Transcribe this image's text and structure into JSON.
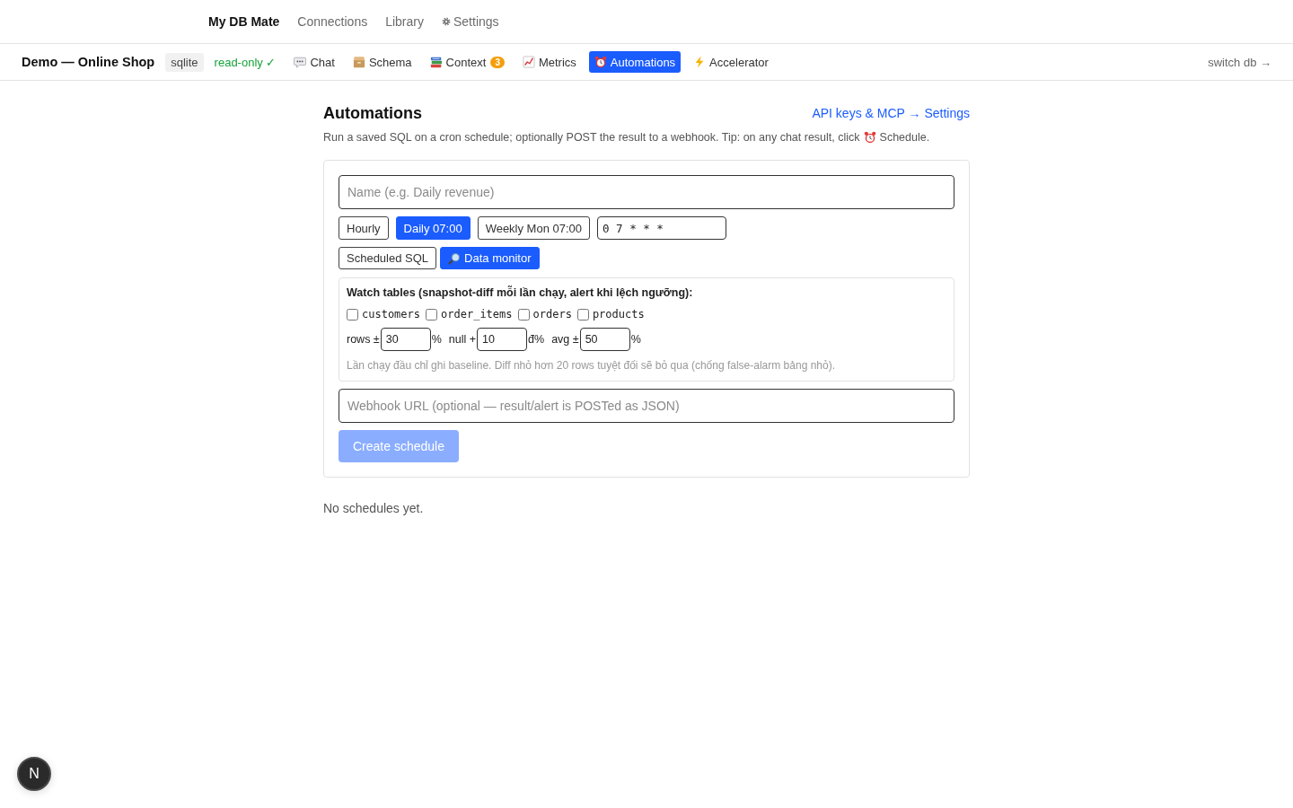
{
  "top_nav": {
    "brand": "My DB Mate",
    "links": [
      {
        "label": "Connections"
      },
      {
        "label": "Library"
      },
      {
        "label": "Settings"
      }
    ]
  },
  "db_bar": {
    "db_name": "Demo — Online Shop",
    "engine": "sqlite",
    "access": "read-only ✓",
    "tabs": [
      {
        "label": "Chat",
        "selected": false
      },
      {
        "label": "Schema",
        "selected": false
      },
      {
        "label": "Context",
        "badge": "3",
        "selected": false
      },
      {
        "label": "Metrics",
        "selected": false
      },
      {
        "label": "Automations",
        "selected": true
      },
      {
        "label": "Accelerator",
        "selected": false
      }
    ],
    "switch_link": "switch db →"
  },
  "page": {
    "title": "Automations",
    "settings_link": "API keys & MCP → Settings",
    "description": {
      "text": "Run a saved SQL on a cron schedule; optionally POST the result to a webhook. Tip: on any chat result, click",
      "after_icon": "Schedule."
    }
  },
  "form": {
    "name_field": {
      "placeholder": "Name (e.g. Daily revenue)"
    },
    "presets": [
      {
        "label": "Hourly",
        "selected": false
      },
      {
        "label": "Daily 07:00",
        "selected": true
      },
      {
        "label": "Weekly Mon 07:00",
        "selected": false
      }
    ],
    "cron_field": {
      "value": "0 7 * * *"
    },
    "modes": [
      {
        "label": "Scheduled SQL",
        "selected": false
      },
      {
        "label": "Data monitor",
        "selected": true
      }
    ],
    "monitor": {
      "title": "Watch tables (snapshot-diff mỗi lần chạy, alert khi lệch ngưỡng):",
      "tables": [
        {
          "label": "customers",
          "checked": false
        },
        {
          "label": "order_items",
          "checked": false
        },
        {
          "label": "orders",
          "checked": false
        },
        {
          "label": "products",
          "checked": false
        }
      ],
      "thresholds": [
        {
          "label": "rows ±",
          "value": "30",
          "unit": "%"
        },
        {
          "label": "null +",
          "value": "10",
          "unit": "đ%"
        },
        {
          "label": "avg ±",
          "value": "50",
          "unit": "%"
        }
      ],
      "note": "Lần chạy đầu chỉ ghi baseline. Diff nhỏ hơn 20 rows tuyệt đối sẽ bỏ qua (chống false-alarm bảng nhỏ)."
    },
    "webhook_field": {
      "placeholder": "Webhook URL (optional — result/alert is POSTed as JSON)"
    },
    "create_button": {
      "label": "Create schedule",
      "disabled": true
    }
  },
  "empty_state": "No schedules yet.",
  "dev_indicator": {
    "label": "N"
  }
}
